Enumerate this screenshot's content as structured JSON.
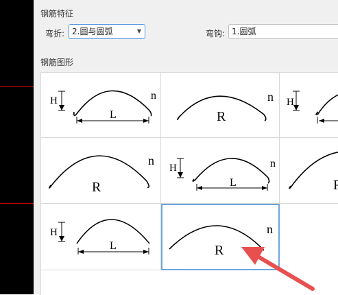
{
  "features": {
    "title": "钢筋特征",
    "bend_label": "弯折:",
    "bend_value": "2.圆与圆弧",
    "hook_label": "弯钩:",
    "hook_value": "1.圆弧"
  },
  "shapes": {
    "title": "钢筋图形",
    "symbols": {
      "H": "H",
      "L": "L",
      "R": "R",
      "n": "n"
    }
  },
  "colors": {
    "accent": "#4a90d9",
    "selected": "#6aa7dc",
    "pointer": "#e8504f"
  }
}
